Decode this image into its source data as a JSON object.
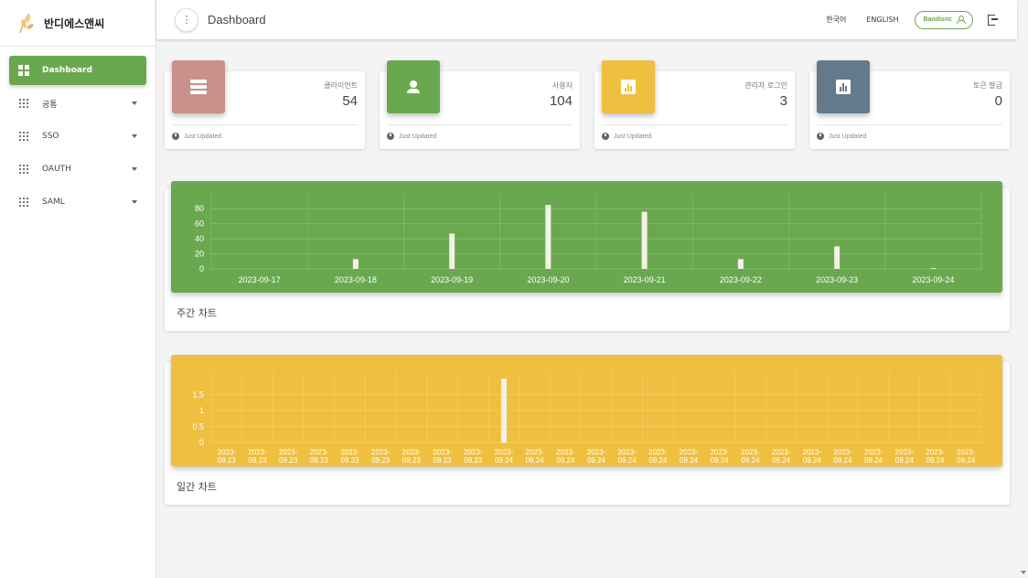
{
  "brand": {
    "name": "반디에스앤씨",
    "logo_icon": "wheat-logo-icon"
  },
  "sidebar": {
    "items": [
      {
        "label": "Dashboard",
        "icon": "dashboard-icon",
        "active": true
      },
      {
        "label": "공통",
        "icon": "grid-icon"
      },
      {
        "label": "SSO",
        "icon": "grid-icon"
      },
      {
        "label": "OAUTH",
        "icon": "grid-icon"
      },
      {
        "label": "SAML",
        "icon": "grid-icon"
      }
    ]
  },
  "header": {
    "title": "Dashboard",
    "lang_ko": "한국어",
    "lang_en": "ENGLISH",
    "user": "Bandisnc"
  },
  "cards": [
    {
      "label": "클라이언트",
      "value": "54",
      "footer": "Just Updated",
      "color": "#c9908c",
      "icon": "server-icon"
    },
    {
      "label": "사용자",
      "value": "104",
      "footer": "Just Updated",
      "color": "#6aa84f",
      "icon": "person-icon"
    },
    {
      "label": "관리자 로그인",
      "value": "3",
      "footer": "Just Updated",
      "color": "#efc040",
      "icon": "bar-chart-icon"
    },
    {
      "label": "토큰 발급",
      "value": "0",
      "footer": "Just Updated",
      "color": "#637a8c",
      "icon": "bar-chart-icon"
    }
  ],
  "chart_data": [
    {
      "type": "bar",
      "title": "주간 차트",
      "background": "#6aa84f",
      "categories": [
        "2023-09-17",
        "2023-09-18",
        "2023-09-19",
        "2023-09-20",
        "2023-09-21",
        "2023-09-22",
        "2023-09-23",
        "2023-09-24"
      ],
      "values": [
        0,
        13,
        47,
        85,
        76,
        13,
        30,
        1
      ],
      "yticks": [
        "0",
        "20",
        "40",
        "60",
        "80"
      ],
      "ylim": [
        0,
        90
      ],
      "grid": true
    },
    {
      "type": "bar",
      "title": "일간 차트",
      "background": "#efc040",
      "categories": [
        "2023-09-23",
        "2023-09-23",
        "2023-09-23",
        "2023-09-23",
        "2023-09-23",
        "2023-09-23",
        "2023-09-23",
        "2023-09-23",
        "2023-09-23",
        "2023-09-24",
        "2023-09-24",
        "2023-09-24",
        "2023-09-24",
        "2023-09-24",
        "2023-09-24",
        "2023-09-24",
        "2023-09-24",
        "2023-09-24",
        "2023-09-24",
        "2023-09-24",
        "2023-09-24",
        "2023-09-24",
        "2023-09-24",
        "2023-09-24",
        "2023-09-24"
      ],
      "values": [
        0,
        0,
        0,
        0,
        0,
        0,
        0,
        0,
        0,
        2,
        0,
        0,
        0,
        0,
        0,
        0,
        0,
        0,
        0,
        0,
        0,
        0,
        0,
        0,
        0
      ],
      "yticks": [
        "0",
        "0.5",
        "1",
        "1.5"
      ],
      "ylim": [
        0,
        2
      ],
      "grid": true
    }
  ]
}
